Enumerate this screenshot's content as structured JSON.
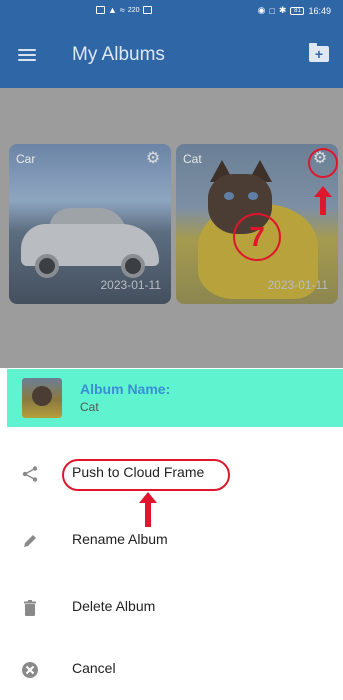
{
  "status_bar": {
    "signal_text": "⁴ᴳ",
    "data_speed": "220",
    "data_unit": "B/s",
    "battery": "81",
    "time": "16:49"
  },
  "app_bar": {
    "title": "My Albums"
  },
  "albums": [
    {
      "name": "Car",
      "date": "2023-01-11"
    },
    {
      "name": "Cat",
      "date": "2023-01-11"
    }
  ],
  "annotations": {
    "step_number": "7"
  },
  "sheet": {
    "album_name_label": "Album Name:",
    "album_name_value": "Cat",
    "items": [
      {
        "label": "Push to Cloud Frame",
        "icon": "share-icon"
      },
      {
        "label": "Rename Album",
        "icon": "pencil-icon"
      },
      {
        "label": "Delete Album",
        "icon": "trash-icon"
      },
      {
        "label": "Cancel",
        "icon": "cancel-icon"
      }
    ]
  },
  "colors": {
    "app_bar": "#2f66a6",
    "overlay": "#9c9c9c",
    "sheet_header": "#5ff3d0",
    "album_name_label": "#3a8fd6",
    "annotation": "#e0162c"
  }
}
